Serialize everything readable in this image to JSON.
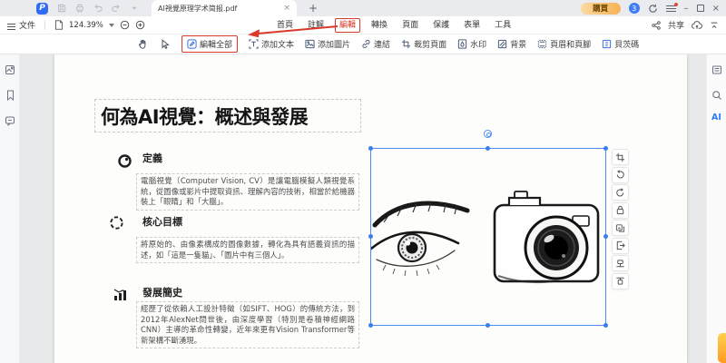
{
  "titlebar": {
    "tab_title": "AI視覺原理学术简报.pdf",
    "close_tab_glyph": "×",
    "new_tab_glyph": "+",
    "buy_label": "購買",
    "notification_count": "3",
    "minimize_glyph": "–",
    "close_glyph": "×"
  },
  "menubar": {
    "file_label": "文件",
    "zoom_value": "124.39%",
    "menus": [
      {
        "label": "首頁",
        "active": false
      },
      {
        "label": "註解",
        "active": false
      },
      {
        "label": "編輯",
        "active": true
      },
      {
        "label": "轉換",
        "active": false
      },
      {
        "label": "頁面",
        "active": false
      },
      {
        "label": "保護",
        "active": false
      },
      {
        "label": "表單",
        "active": false
      },
      {
        "label": "工具",
        "active": false
      }
    ],
    "share_label": "共享"
  },
  "toolbar": {
    "buttons": [
      {
        "label": "編輯全部",
        "icon": "edit-all-pencil-icon",
        "highlighted": true
      },
      {
        "label": "添加文本",
        "icon": "add-text-icon",
        "highlighted": false
      },
      {
        "label": "添加圖片",
        "icon": "add-image-icon",
        "highlighted": false
      },
      {
        "label": "連結",
        "icon": "link-icon",
        "highlighted": false
      },
      {
        "label": "裁剪頁面",
        "icon": "crop-page-icon",
        "highlighted": false
      },
      {
        "label": "水印",
        "icon": "watermark-icon",
        "highlighted": false
      },
      {
        "label": "背景",
        "icon": "background-icon",
        "highlighted": false
      },
      {
        "label": "頁眉和頁腳",
        "icon": "header-footer-icon",
        "highlighted": false
      },
      {
        "label": "貝茨碼",
        "icon": "bates-number-icon",
        "highlighted": false
      }
    ]
  },
  "document": {
    "title": "何為AI視覺：概述與發展",
    "sections": [
      {
        "heading": "定義",
        "icon": "lens-icon",
        "body": "電腦視覺（Computer Vision, CV）是讓電腦模擬人類視覺系統，從圖像或影片中提取資訊、理解內容的技術，相當於給機器裝上「眼睛」和「大腦」。"
      },
      {
        "heading": "核心目標",
        "icon": "viewfinder-icon",
        "body": "將原始的、由像素構成的圖像數據，轉化為具有語義資訊的描述，如「這是一隻貓」、「圖片中有三個人」。"
      },
      {
        "heading": "發展簡史",
        "icon": "bar-chart-icon",
        "body": "經歷了從依賴人工設計特徵（如SIFT、HOG）的傳統方法，到2012年AlexNet問世後，由深度學習（特別是卷積神經網路CNN）主導的革命性轉變，近年來更有Vision Transformer等新架構不斷湧現。"
      }
    ]
  },
  "right_sidebar": {
    "ai_label": "AI"
  },
  "accent_colors": {
    "annotation_red": "#d93a2b",
    "selection_blue": "#4c8bf5",
    "buy_gradient_start": "#fbd9a2",
    "buy_gradient_end": "#f5b254"
  }
}
